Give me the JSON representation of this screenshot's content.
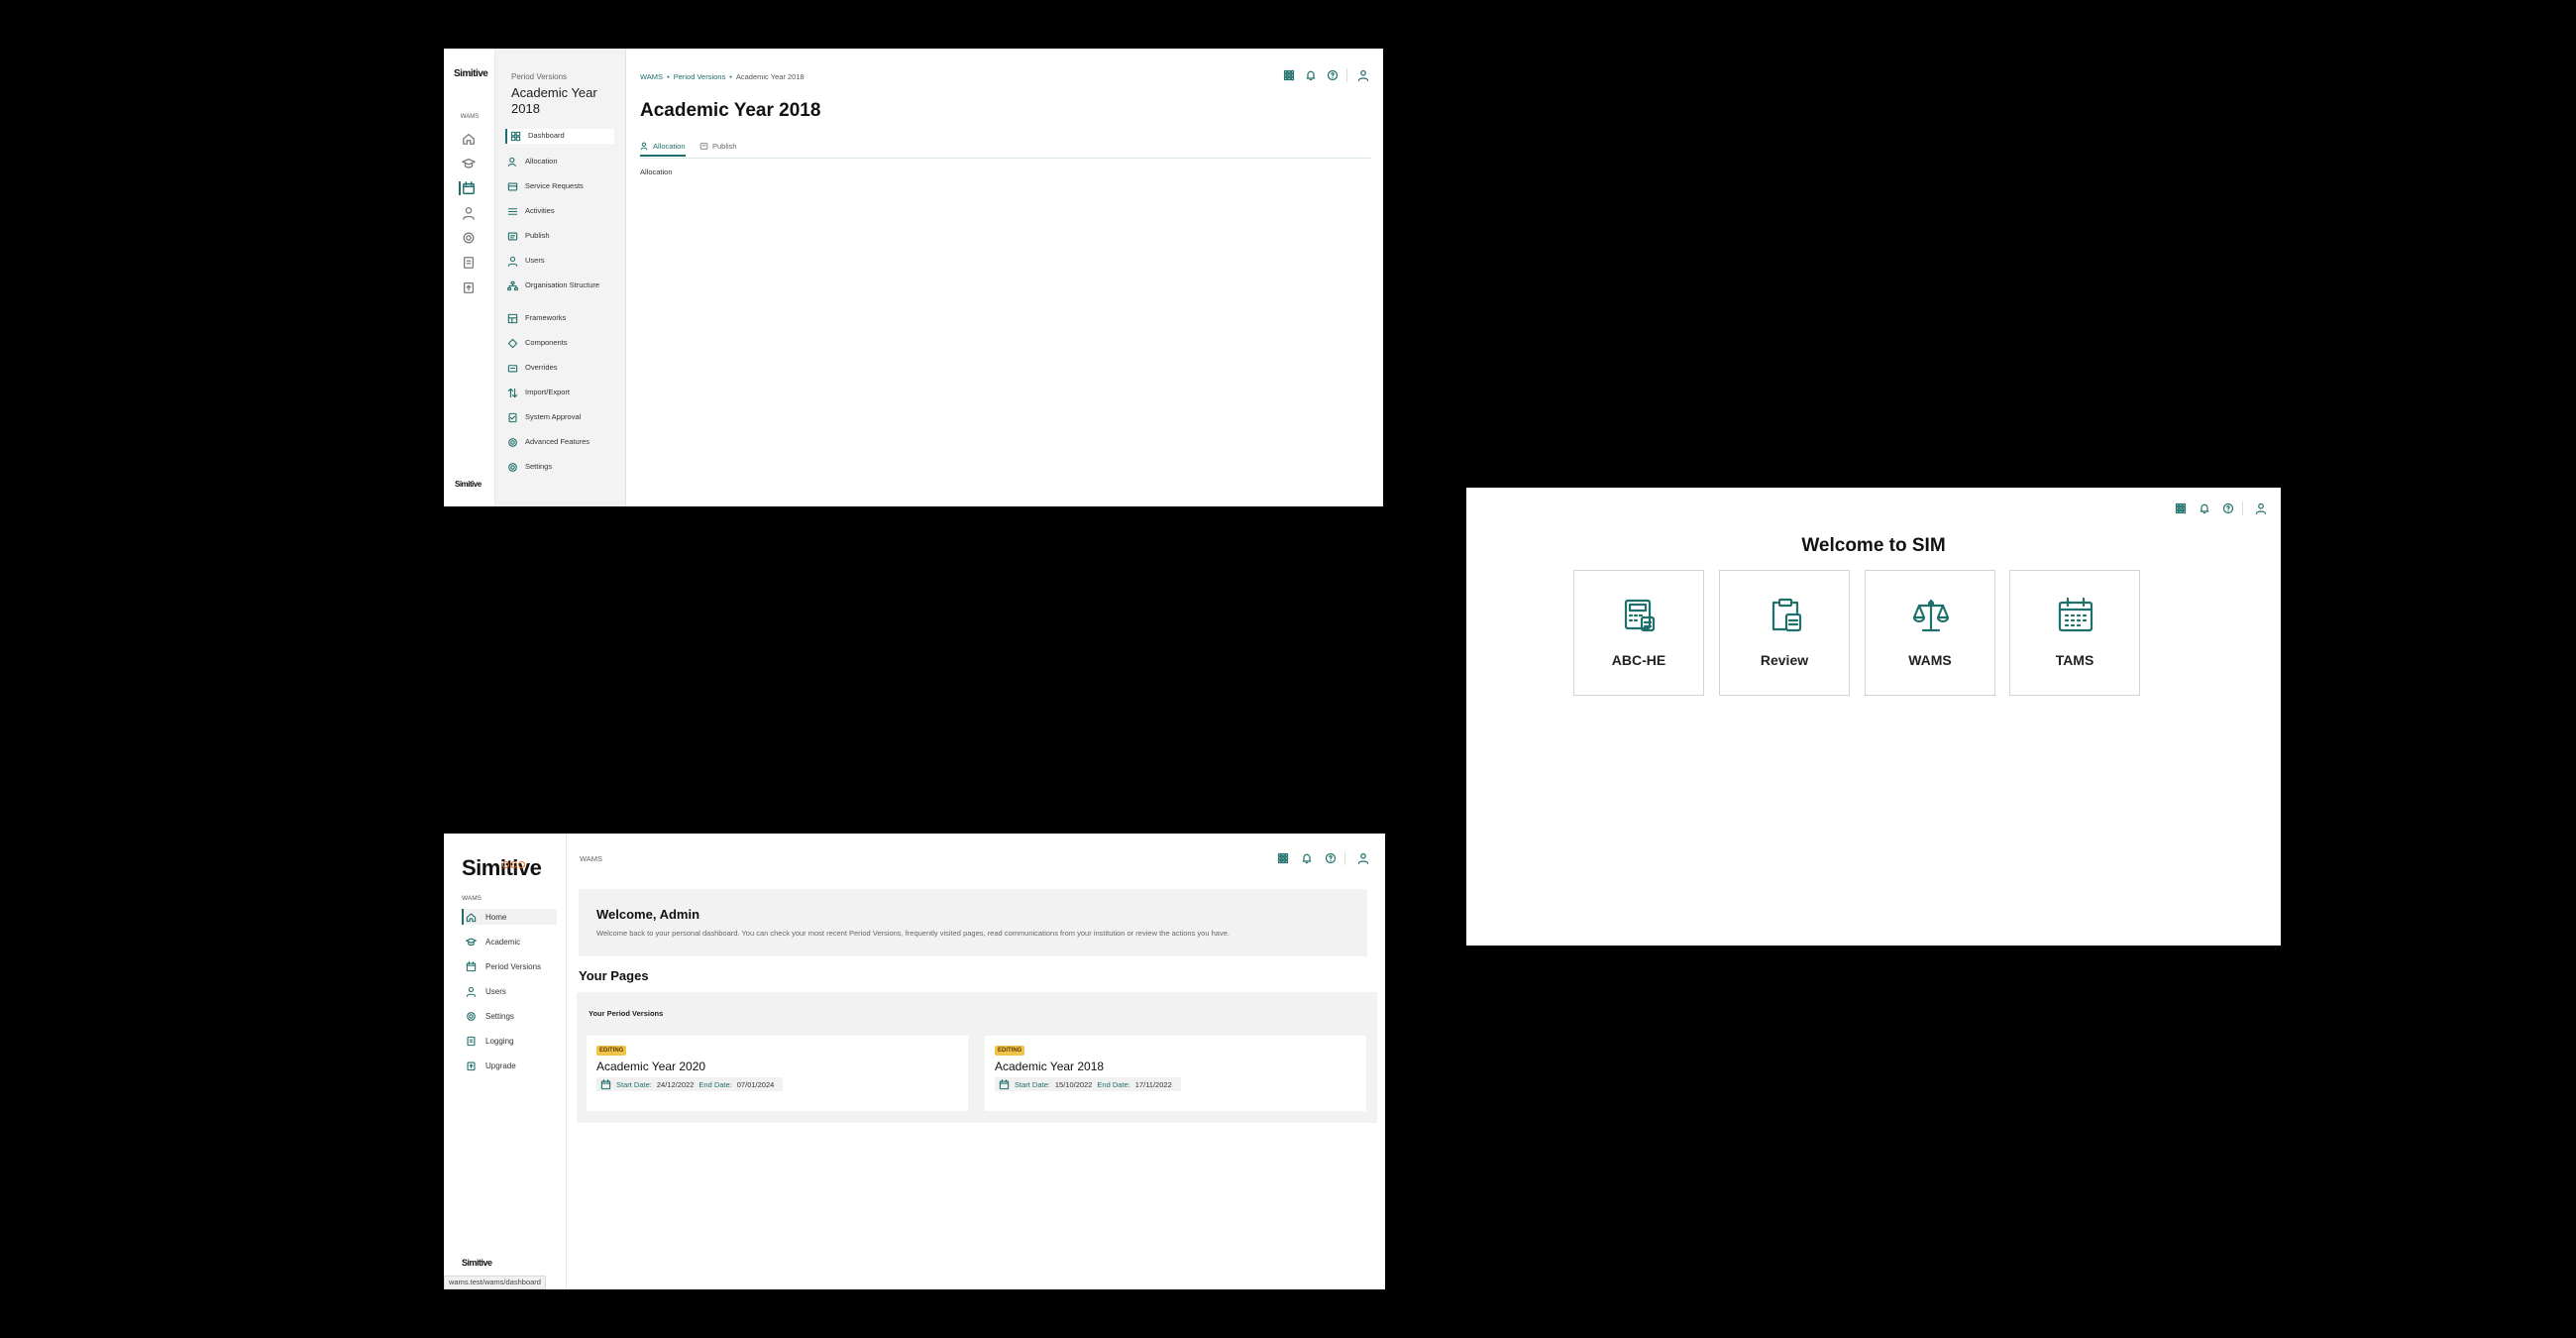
{
  "window1": {
    "rail": {
      "logo": "Simitive",
      "label": "WAMS",
      "icons": [
        "home-icon",
        "graduation-cap-icon",
        "calendar-icon",
        "user-icon",
        "gear-icon",
        "logging-icon",
        "upgrade-icon"
      ],
      "footer_logo": "Simitive"
    },
    "subnav": {
      "caption": "Period Versions",
      "title": "Academic Year 2018",
      "items": [
        {
          "label": "Dashboard",
          "icon": "dashboard-icon"
        },
        {
          "label": "Allocation",
          "icon": "allocation-icon"
        },
        {
          "label": "Service Requests",
          "icon": "service-requests-icon"
        },
        {
          "label": "Activities",
          "icon": "activities-icon"
        },
        {
          "label": "Publish",
          "icon": "publish-icon"
        },
        {
          "label": "Users",
          "icon": "users-icon"
        },
        {
          "label": "Organisation Structure",
          "icon": "org-structure-icon"
        },
        {
          "label": "Frameworks",
          "icon": "frameworks-icon"
        },
        {
          "label": "Components",
          "icon": "components-icon"
        },
        {
          "label": "Overrides",
          "icon": "overrides-icon"
        },
        {
          "label": "Import/Export",
          "icon": "import-export-icon"
        },
        {
          "label": "System Approval",
          "icon": "system-approval-icon"
        },
        {
          "label": "Advanced Features",
          "icon": "advanced-features-icon"
        },
        {
          "label": "Settings",
          "icon": "settings-icon"
        }
      ]
    },
    "breadcrumb": {
      "root": "WAMS",
      "mid": "Period Versions",
      "current": "Academic Year 2018"
    },
    "topbar_icons": [
      "apps-grid-icon",
      "bell-icon",
      "help-icon",
      "account-icon"
    ],
    "heading": "Academic Year 2018",
    "tabs": [
      {
        "label": "Allocation",
        "active": true
      },
      {
        "label": "Publish",
        "active": false
      }
    ],
    "content_text": "Allocation"
  },
  "window2": {
    "topbar_icons": [
      "apps-grid-icon",
      "bell-icon",
      "help-icon",
      "account-icon"
    ],
    "welcome": "Welcome to SIM",
    "apps": [
      {
        "label": "ABC-HE",
        "icon": "calculator-icon"
      },
      {
        "label": "Review",
        "icon": "clipboard-icon"
      },
      {
        "label": "WAMS",
        "icon": "scales-icon"
      },
      {
        "label": "TAMS",
        "icon": "calendar-grid-icon"
      }
    ]
  },
  "window3": {
    "logo": "Simitive",
    "section_label": "WAMS",
    "nav": [
      {
        "label": "Home",
        "icon": "home-icon"
      },
      {
        "label": "Academic",
        "icon": "graduation-cap-icon"
      },
      {
        "label": "Period Versions",
        "icon": "calendar-icon"
      },
      {
        "label": "Users",
        "icon": "user-icon"
      },
      {
        "label": "Settings",
        "icon": "gear-icon"
      },
      {
        "label": "Logging",
        "icon": "logging-icon"
      },
      {
        "label": "Upgrade",
        "icon": "upgrade-icon"
      }
    ],
    "footer_logo": "Simitive",
    "status_url": "wams.test/wams/dashboard",
    "breadcrumb": "WAMS",
    "topbar_icons": [
      "apps-grid-icon",
      "bell-icon",
      "help-icon",
      "account-icon"
    ],
    "hero": {
      "title": "Welcome, Admin",
      "subtitle": "Welcome back to your personal dashboard. You can check your most recent Period Versions, frequently visited pages, read communications from your institution or review the actions you have."
    },
    "your_pages": "Your Pages",
    "panel_title": "Your Period Versions",
    "period_versions": [
      {
        "badge": "EDITING",
        "name": "Academic Year 2020",
        "start_label": "Start Date:",
        "start": "24/12/2022",
        "end_label": "End Date:",
        "end": "07/01/2024"
      },
      {
        "badge": "EDITING",
        "name": "Academic Year 2018",
        "start_label": "Start Date:",
        "start": "15/10/2022",
        "end_label": "End Date:",
        "end": "17/11/2022"
      }
    ]
  },
  "colors": {
    "accent": "#1f6f6a",
    "badge": "#f3c24a",
    "logo_dots": "#e06a2a",
    "background": "#000000"
  }
}
